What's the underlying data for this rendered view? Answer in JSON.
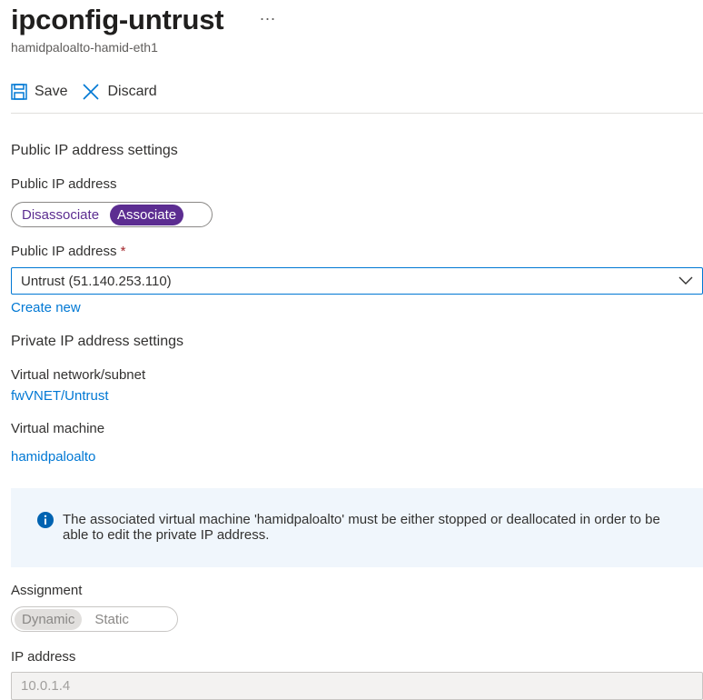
{
  "header": {
    "title": "ipconfig-untrust",
    "more": "...",
    "subtitle": "hamidpaloalto-hamid-eth1"
  },
  "toolbar": {
    "save_label": "Save",
    "save_icon": "save-icon",
    "discard_label": "Discard",
    "discard_icon": "close-icon"
  },
  "public_ip": {
    "section_title": "Public IP address settings",
    "toggle_label": "Public IP address",
    "toggle_options": [
      "Disassociate",
      "Associate"
    ],
    "toggle_selected": "Associate",
    "dropdown_label": "Public IP address",
    "required_marker": "*",
    "dropdown_value": "Untrust (51.140.253.110)",
    "create_new": "Create new"
  },
  "private_ip": {
    "section_title": "Private IP address settings",
    "vnet_label": "Virtual network/subnet",
    "vnet_value": "fwVNET/Untrust",
    "vm_label": "Virtual machine",
    "vm_value": "hamidpaloalto",
    "info_text": "The associated virtual machine 'hamidpaloalto' must be either stopped or deallocated in order to be able to edit the private IP address.",
    "assignment_label": "Assignment",
    "assignment_options": [
      "Dynamic",
      "Static"
    ],
    "assignment_selected": "Dynamic",
    "ip_label": "IP address",
    "ip_value": "10.0.1.4"
  },
  "colors": {
    "accent": "#0078d4",
    "toggle": "#5c2d91",
    "required": "#a4262c",
    "info_bg": "#f0f6fc"
  }
}
